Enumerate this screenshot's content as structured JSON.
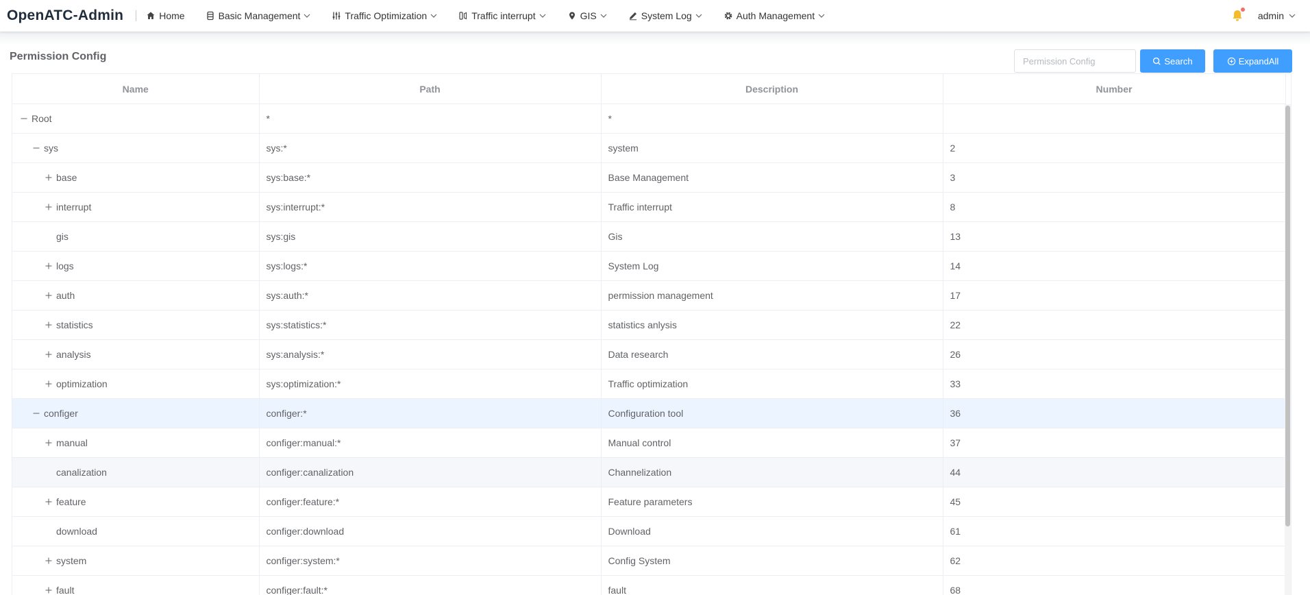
{
  "header": {
    "logo": "OpenATC-Admin",
    "nav": [
      {
        "label": "Home",
        "icon": "home-icon",
        "dropdown": false
      },
      {
        "label": "Basic Management",
        "icon": "box-icon",
        "dropdown": true
      },
      {
        "label": "Traffic Optimization",
        "icon": "sliders-icon",
        "dropdown": true
      },
      {
        "label": "Traffic interrupt",
        "icon": "signal-icon",
        "dropdown": true
      },
      {
        "label": "GIS",
        "icon": "location-icon",
        "dropdown": true
      },
      {
        "label": "System Log",
        "icon": "edit-icon",
        "dropdown": true
      },
      {
        "label": "Auth Management",
        "icon": "gear-icon",
        "dropdown": true
      }
    ],
    "user": "admin",
    "bell_color": "#f7ba2a",
    "bell_dot_color": "#f56c6c"
  },
  "page": {
    "title": "Permission Config",
    "search_placeholder": "Permission Config",
    "search_button": "Search",
    "expand_button": "ExpandAll",
    "accent": "#409eff"
  },
  "table": {
    "columns": [
      "Name",
      "Path",
      "Description",
      "Number"
    ],
    "rows": [
      {
        "name": "Root",
        "level": 0,
        "toggle": "collapse",
        "path": "*",
        "description": "*",
        "number": ""
      },
      {
        "name": "sys",
        "level": 1,
        "toggle": "collapse",
        "path": "sys:*",
        "description": "system",
        "number": "2"
      },
      {
        "name": "base",
        "level": 2,
        "toggle": "expand",
        "path": "sys:base:*",
        "description": "Base Management",
        "number": "3"
      },
      {
        "name": "interrupt",
        "level": 2,
        "toggle": "expand",
        "path": "sys:interrupt:*",
        "description": "Traffic interrupt",
        "number": "8"
      },
      {
        "name": "gis",
        "level": 2,
        "toggle": "none",
        "path": "sys:gis",
        "description": "Gis",
        "number": "13"
      },
      {
        "name": "logs",
        "level": 2,
        "toggle": "expand",
        "path": "sys:logs:*",
        "description": "System Log",
        "number": "14"
      },
      {
        "name": "auth",
        "level": 2,
        "toggle": "expand",
        "path": "sys:auth:*",
        "description": "permission management",
        "number": "17"
      },
      {
        "name": "statistics",
        "level": 2,
        "toggle": "expand",
        "path": "sys:statistics:*",
        "description": "statistics anlysis",
        "number": "22"
      },
      {
        "name": "analysis",
        "level": 2,
        "toggle": "expand",
        "path": "sys:analysis:*",
        "description": "Data research",
        "number": "26"
      },
      {
        "name": "optimization",
        "level": 2,
        "toggle": "expand",
        "path": "sys:optimization:*",
        "description": "Traffic optimization",
        "number": "33"
      },
      {
        "name": "configer",
        "level": 1,
        "toggle": "collapse",
        "path": "configer:*",
        "description": "Configuration tool",
        "number": "36",
        "state": "hover"
      },
      {
        "name": "manual",
        "level": 2,
        "toggle": "expand",
        "path": "configer:manual:*",
        "description": "Manual control",
        "number": "37"
      },
      {
        "name": "canalization",
        "level": 2,
        "toggle": "none",
        "path": "configer:canalization",
        "description": "Channelization",
        "number": "44",
        "state": "striped"
      },
      {
        "name": "feature",
        "level": 2,
        "toggle": "expand",
        "path": "configer:feature:*",
        "description": "Feature parameters",
        "number": "45"
      },
      {
        "name": "download",
        "level": 2,
        "toggle": "none",
        "path": "configer:download",
        "description": "Download",
        "number": "61"
      },
      {
        "name": "system",
        "level": 2,
        "toggle": "expand",
        "path": "configer:system:*",
        "description": "Config System",
        "number": "62"
      },
      {
        "name": "fault",
        "level": 2,
        "toggle": "expand",
        "path": "configer:fault:*",
        "description": "fault",
        "number": "68"
      }
    ]
  }
}
